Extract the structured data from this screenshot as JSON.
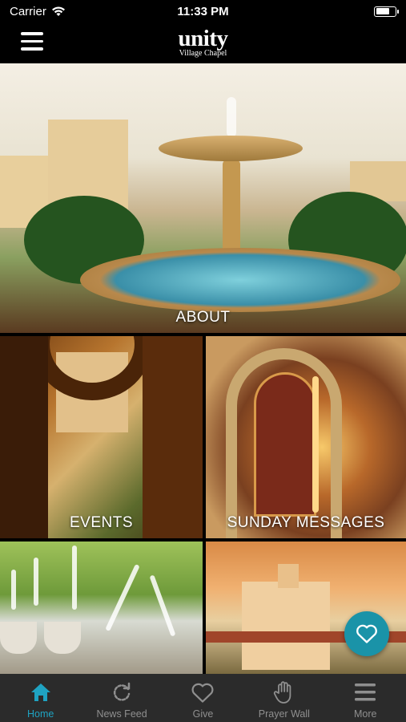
{
  "status_bar": {
    "carrier": "Carrier",
    "time": "11:33 PM",
    "battery_level": 0.75
  },
  "header": {
    "logo_main": "unity",
    "logo_sub": "Village Chapel",
    "menu_icon": "hamburger-menu-icon"
  },
  "tiles": {
    "about": "ABOUT",
    "events": "EVENTS",
    "sunday_messages": "SUNDAY MESSAGES"
  },
  "fab": {
    "icon": "heart-icon",
    "color": "#1a93a8"
  },
  "tab_bar": {
    "active_color": "#1fa3c2",
    "inactive_color": "#8f8f8f",
    "items": [
      {
        "label": "Home",
        "icon": "home-icon"
      },
      {
        "label": "News Feed",
        "icon": "refresh-icon"
      },
      {
        "label": "Give",
        "icon": "heart-icon"
      },
      {
        "label": "Prayer Wall",
        "icon": "hand-icon"
      },
      {
        "label": "More",
        "icon": "menu-icon"
      }
    ]
  }
}
